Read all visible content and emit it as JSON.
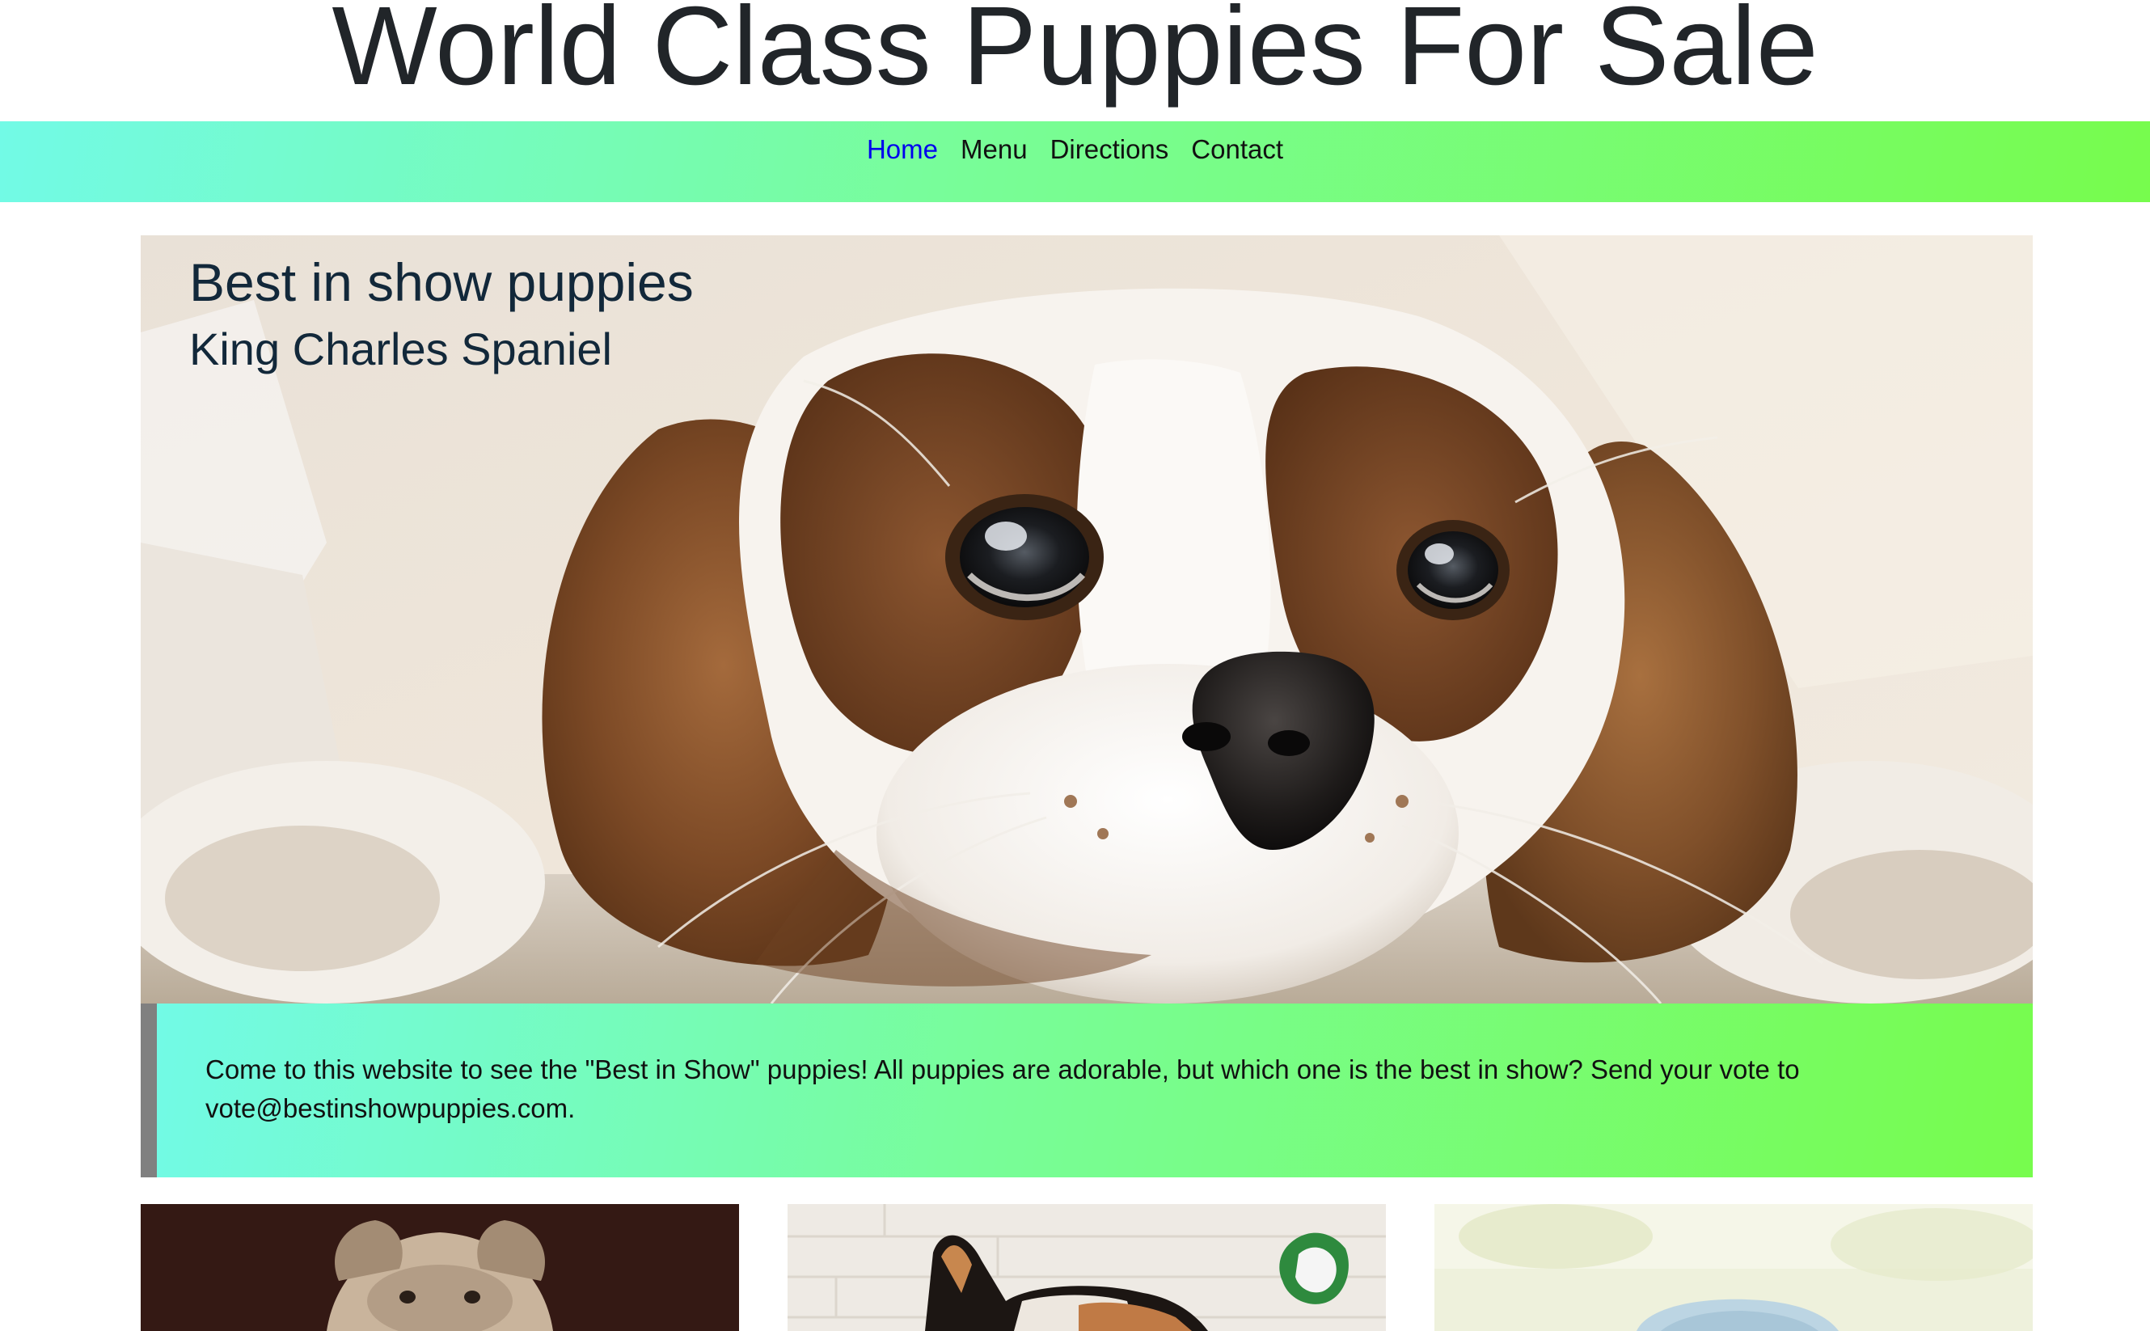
{
  "header": {
    "title": "World Class Puppies For Sale"
  },
  "nav": {
    "items": [
      {
        "label": "Home",
        "active": true
      },
      {
        "label": "Menu",
        "active": false
      },
      {
        "label": "Directions",
        "active": false
      },
      {
        "label": "Contact",
        "active": false
      }
    ]
  },
  "hero": {
    "title": "Best in show puppies",
    "subtitle": "King Charles Spaniel",
    "image": "king-charles-spaniel-photo"
  },
  "info": {
    "text": "Come to this website to see the \"Best in Show\" puppies! All puppies are adorable, but which one is the best in show? Send your vote to vote@bestinshowpuppies.com."
  },
  "cards": [
    {
      "image": "pug-puppy-photo"
    },
    {
      "image": "corgi-puppy-photo"
    },
    {
      "image": "fluffy-puppy-photo"
    }
  ],
  "colors": {
    "gradient_start": "#72fae6",
    "gradient_end": "#77fc4d",
    "active_link": "#0000ee",
    "info_border": "#808080",
    "title_text": "#212529"
  }
}
